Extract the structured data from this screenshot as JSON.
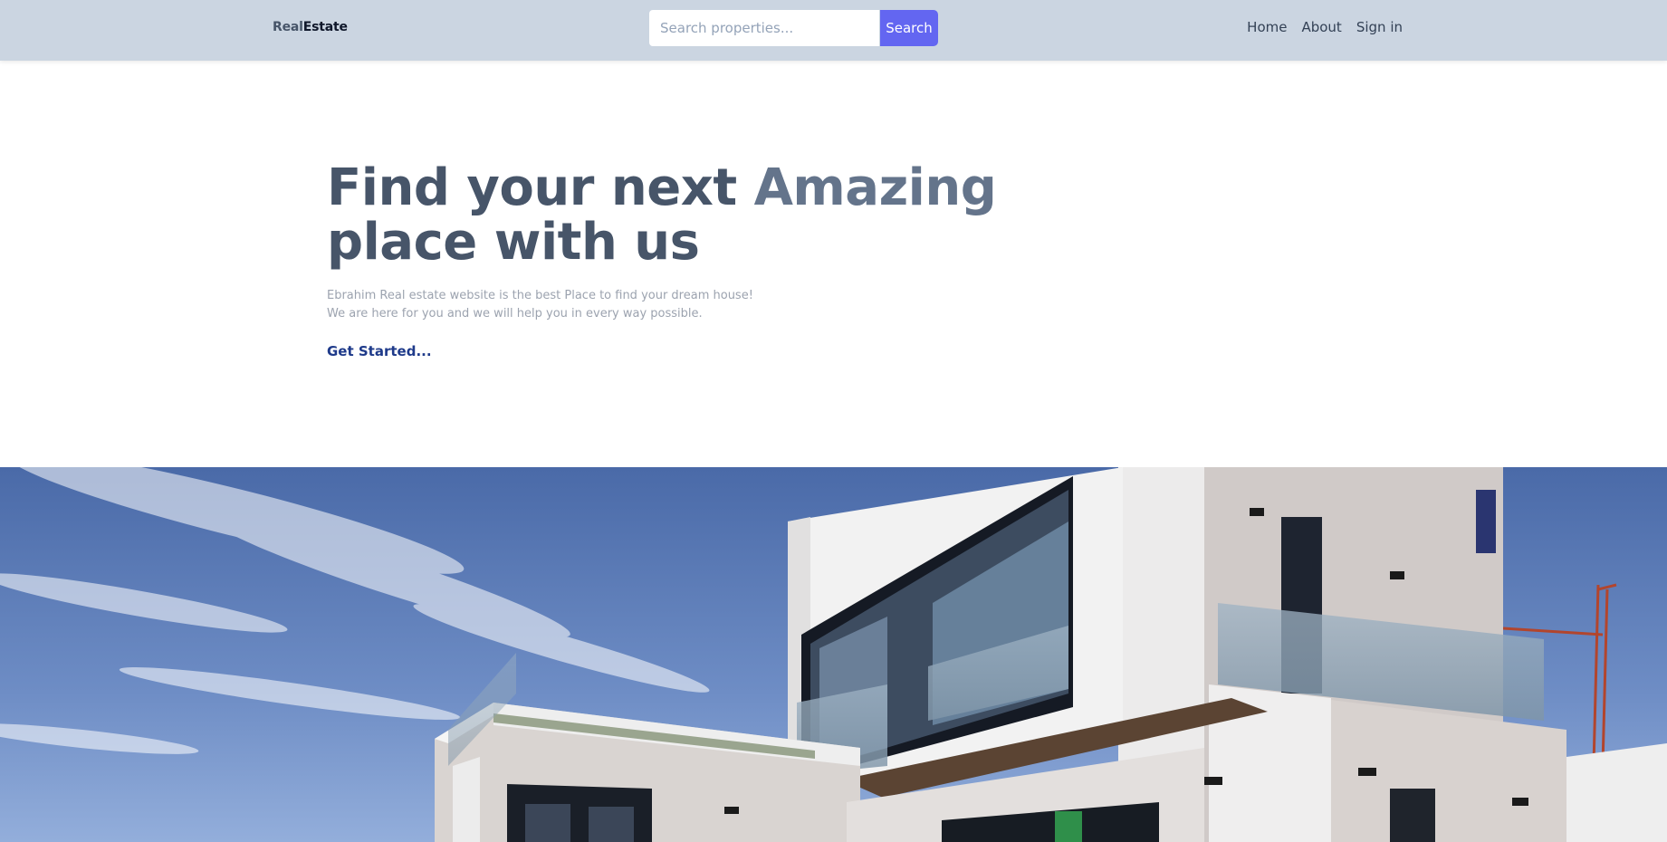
{
  "header": {
    "logo": {
      "part1": "Real",
      "part2": "Estate"
    },
    "search": {
      "placeholder": "Search properties...",
      "value": "",
      "button_label": "Search"
    },
    "nav": [
      {
        "label": "Home"
      },
      {
        "label": "About"
      },
      {
        "label": "Sign in"
      }
    ]
  },
  "hero": {
    "title_main": "Find your next ",
    "title_accent": "Amazing",
    "title_end": "place with us",
    "description": [
      "Ebrahim Real estate website is the best Place to find your dream house!",
      "We are here for you and we will help you in every way possible."
    ],
    "cta_label": "Get Started..."
  },
  "colors": {
    "header_bg": "#cbd5e1",
    "accent": "#6366f1",
    "title": "#475569",
    "title_accent": "#64748b",
    "cta": "#1e3a8a"
  }
}
